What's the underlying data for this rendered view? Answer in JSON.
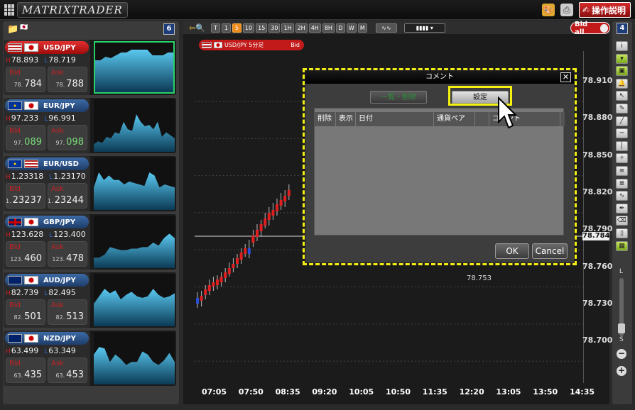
{
  "app": {
    "logo": "MATRIXTRADER",
    "help_label": "操作説明"
  },
  "left_panel": {
    "count": "6"
  },
  "pairs": [
    {
      "name": "USD/JPY",
      "high": "78.893",
      "low": "78.719",
      "bid_label": "Bid",
      "ask_label": "Ask",
      "bid_big": "78.",
      "bid": "784",
      "ask_big": "78.",
      "ask": "788",
      "selected": true,
      "flag1": "us",
      "flag2": "jp",
      "spark": [
        25,
        25,
        20,
        22,
        18,
        14,
        14,
        10,
        10,
        10,
        10,
        18,
        18,
        18,
        14,
        14
      ]
    },
    {
      "name": "EUR/JPY",
      "high": "97.233",
      "low": "96.991",
      "bid_label": "Bid",
      "ask_label": "Ask",
      "bid_big": "97.",
      "bid": "089",
      "ask_big": "97.",
      "ask": "098",
      "selected": false,
      "flag1": "eu",
      "flag2": "jp",
      "spark": [
        60,
        56,
        58,
        50,
        52,
        44,
        46,
        30,
        40,
        42,
        20,
        30,
        36,
        34,
        40,
        30,
        50,
        44,
        48,
        52
      ]
    },
    {
      "name": "EUR/USD",
      "high": "1.23318",
      "low": "1.23170",
      "bid_label": "Bid",
      "ask_label": "Ask",
      "bid_big": "1.",
      "bid": "23237",
      "ask_big": "1.",
      "ask": "23244",
      "selected": false,
      "flag1": "eu",
      "flag2": "us",
      "spark": [
        40,
        20,
        30,
        24,
        30,
        30,
        36,
        32,
        34,
        36,
        38,
        20,
        24,
        40,
        36,
        38,
        40
      ]
    },
    {
      "name": "GBP/JPY",
      "high": "123.628",
      "low": "123.400",
      "bid_label": "Bid",
      "ask_label": "Ask",
      "bid_big": "123.",
      "bid": "460",
      "ask_big": "123.",
      "ask": "478",
      "selected": false,
      "flag1": "gb",
      "flag2": "jp",
      "spark": [
        56,
        56,
        52,
        42,
        44,
        46,
        46,
        44,
        44,
        42,
        42,
        36,
        40,
        30,
        24,
        30
      ]
    },
    {
      "name": "AUD/JPY",
      "high": "82.739",
      "low": "82.495",
      "bid_label": "Bid",
      "ask_label": "Ask",
      "bid_big": "82.",
      "bid": "501",
      "ask_big": "82.",
      "ask": "513",
      "selected": false,
      "flag1": "au",
      "flag2": "jp",
      "spark": [
        40,
        30,
        20,
        26,
        22,
        34,
        28,
        24,
        30,
        32,
        30,
        20,
        28,
        32,
        30,
        26
      ]
    },
    {
      "name": "NZD/JPY",
      "high": "63.499",
      "low": "63.349",
      "bid_label": "Bid",
      "ask_label": "Ask",
      "bid_big": "63.",
      "bid": "435",
      "ask_big": "63.",
      "ask": "453",
      "selected": false,
      "flag1": "nz",
      "flag2": "jp",
      "spark": [
        30,
        20,
        22,
        40,
        30,
        36,
        44,
        40,
        40,
        26,
        30,
        40,
        44,
        38,
        28,
        40
      ]
    }
  ],
  "chart": {
    "timeframes": [
      "T",
      "1",
      "5",
      "10",
      "15",
      "30",
      "1H",
      "2H",
      "4H",
      "8H",
      "D",
      "W",
      "M"
    ],
    "active_timeframe": "5",
    "bid_all": "Bid all",
    "right_count": "4",
    "pair_label": "USD/JPY 5分足",
    "price_type": "Bid",
    "current_price": "78.784",
    "callout_price": "78.753",
    "y_ticks": [
      "78.910",
      "78.880",
      "78.850",
      "78.820",
      "78.790",
      "78.760",
      "78.730",
      "78.700"
    ],
    "x_ticks": [
      "07:05",
      "07:50",
      "08:35",
      "09:20",
      "10:05",
      "10:50",
      "11:35",
      "12:20",
      "13:05",
      "13:50",
      "14:35"
    ],
    "slider_top": "L",
    "slider_bottom": "S"
  },
  "dialog": {
    "title": "コメント",
    "tab_list": "一覧・削除",
    "tab_settings": "設定",
    "columns": [
      "削除",
      "表示",
      "日付",
      "通貨ペア",
      "",
      "コメント"
    ],
    "ok_label": "OK",
    "cancel_label": "Cancel"
  }
}
